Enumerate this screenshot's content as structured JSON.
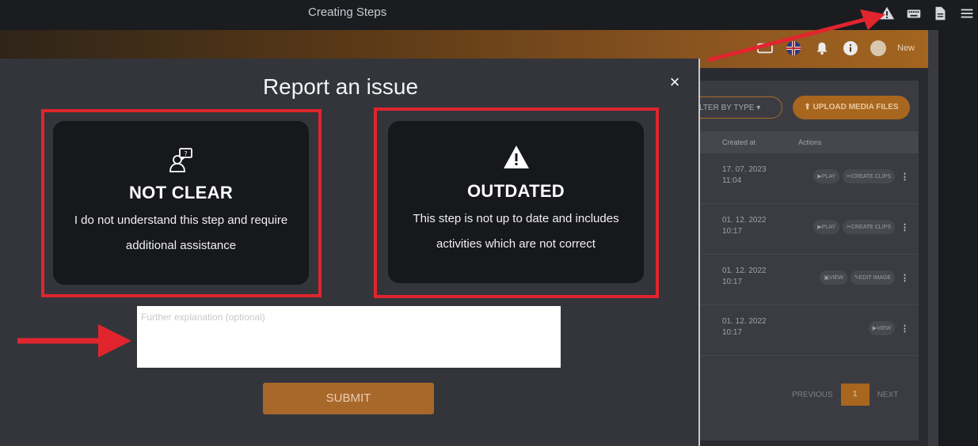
{
  "topbar": {
    "title": "Creating Steps",
    "icons": [
      "warning-icon",
      "keyboard-icon",
      "document-icon",
      "menu-icon"
    ]
  },
  "app_header": {
    "icons": [
      "media-icon",
      "uk-flag-icon",
      "bell-icon",
      "info-icon",
      "avatar"
    ],
    "user_label": "New"
  },
  "media_panel": {
    "filter_label": "LTER BY TYPE",
    "upload_label": "UPLOAD MEDIA FILES",
    "columns": [
      "Created at",
      "Actions"
    ],
    "rows": [
      {
        "date": "17. 07. 2023",
        "time": "11:04",
        "actions": [
          "PLAY",
          "CREATE CLIPS"
        ]
      },
      {
        "date": "01. 12. 2022",
        "time": "10:17",
        "actions": [
          "PLAY",
          "CREATE CLIPS"
        ]
      },
      {
        "date": "01. 12. 2022",
        "time": "10:17",
        "actions": [
          "VIEW",
          "EDIT IMAGE"
        ]
      },
      {
        "date": "01. 12. 2022",
        "time": "10:17",
        "actions": [
          "VIEW"
        ]
      }
    ],
    "pager": {
      "previous": "PREVIOUS",
      "page": "1",
      "next": "NEXT"
    }
  },
  "modal": {
    "title": "Report an issue",
    "close": "×",
    "options": [
      {
        "title": "NOT CLEAR",
        "desc_line1": "I do not understand this step and require",
        "desc_line2": "additional assistance",
        "icon": "confused-person-icon"
      },
      {
        "title": "OUTDATED",
        "desc_line1": "This step is not up to date and includes",
        "desc_line2": "activities which are not correct",
        "icon": "warning-icon"
      }
    ],
    "explanation_placeholder": "Further explanation (optional)",
    "explanation_value": "",
    "submit_label": "SUBMIT"
  },
  "colors": {
    "annotation": "#e0252e",
    "accent": "#a8682a",
    "modal_bg": "#33353b",
    "card_bg": "#17181c"
  }
}
